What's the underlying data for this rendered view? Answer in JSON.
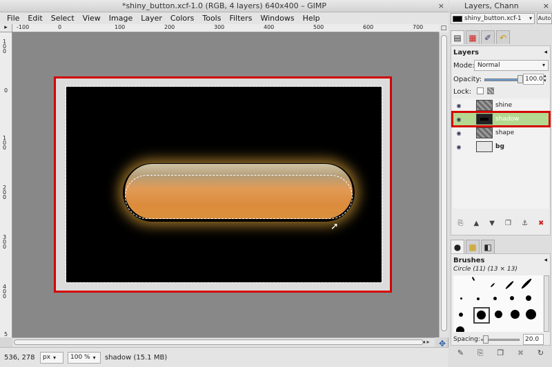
{
  "window": {
    "title": "*shiny_button.xcf-1.0 (RGB, 4 layers) 640x400 – GIMP",
    "close_glyph": "×"
  },
  "menu": {
    "items": [
      "File",
      "Edit",
      "Select",
      "View",
      "Image",
      "Layer",
      "Colors",
      "Tools",
      "Filters",
      "Windows",
      "Help"
    ]
  },
  "rulers": {
    "horizontal_ticks": [
      "-100",
      "0",
      "100",
      "200",
      "300",
      "400",
      "500",
      "600",
      "700"
    ],
    "vertical_ticks": [
      "1\n0\n0",
      "0",
      "1\n0\n0",
      "2\n0\n0",
      "3\n0\n0",
      "4\n0\n0",
      "5"
    ]
  },
  "status": {
    "coords": "536, 278",
    "unit": "px",
    "zoom": "100 %",
    "message": "shadow (15.1 MB)"
  },
  "dock": {
    "title": "Layers, Chann",
    "image_selector": "shiny_button.xcf-1",
    "auto_label": "Auto"
  },
  "layers_panel": {
    "header": "Layers",
    "mode_label": "Mode:",
    "mode_value": "Normal",
    "opacity_label": "Opacity:",
    "opacity_value": "100.0",
    "opacity": 1.0,
    "lock_label": "Lock:",
    "layers": [
      {
        "name": "shine",
        "visible": true,
        "selected": false
      },
      {
        "name": "shadow",
        "visible": true,
        "selected": true
      },
      {
        "name": "shape",
        "visible": true,
        "selected": false
      },
      {
        "name": "bg",
        "visible": true,
        "selected": false
      }
    ]
  },
  "brushes_panel": {
    "header": "Brushes",
    "brush_name": "Circle (11) (13 × 13)",
    "spacing_label": "Spacing:",
    "spacing_value": "20.0"
  },
  "colors": {
    "selection_highlight": "#d40000",
    "layer_selected_bg": "#b4d890",
    "button_orange": "#dc8c3c"
  }
}
